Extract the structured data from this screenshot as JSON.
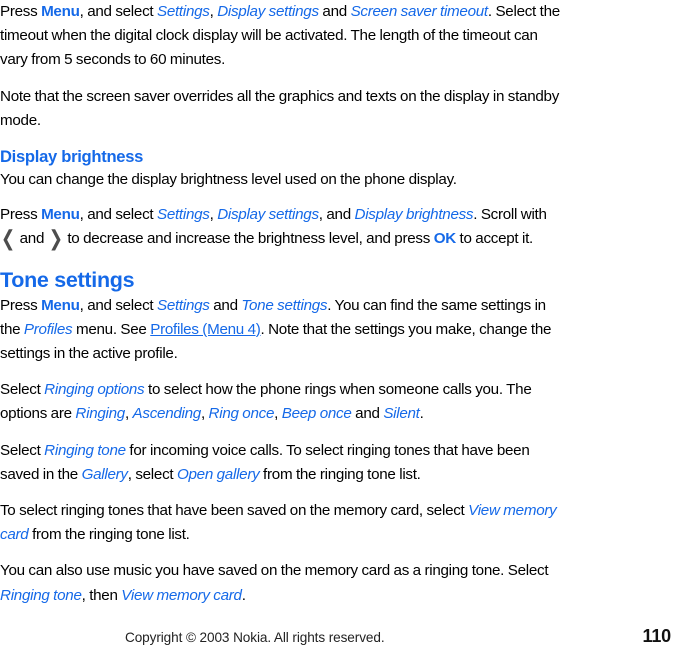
{
  "document": {
    "type": "user-guide-page",
    "accent_color": "#1569e8",
    "body_color": "#000000",
    "chevron_color": "#4d4d4d",
    "page_number": "110",
    "footer_copyright": "Copyright © 2003 Nokia. All rights reserved."
  },
  "blocks": {
    "p1": {
      "s1": "Press ",
      "ui_menu": "Menu",
      "s2": ", and select ",
      "it_settings": "Settings",
      "s3": ", ",
      "it_display_settings": "Display settings",
      "s4": " and ",
      "it_screen_saver_timeout": "Screen saver timeout",
      "s5": ". Select the timeout when the digital clock display will be activated. The length of the timeout can vary from 5 seconds to 60 minutes."
    },
    "p2": {
      "s1": "Note that the screen saver overrides all the graphics and texts on the display in standby mode."
    },
    "h_display_brightness": "Display brightness",
    "p3": {
      "s1": "You can change the display brightness level used on the phone display."
    },
    "p4": {
      "s1": "Press ",
      "ui_menu": "Menu",
      "s2": ", and select ",
      "it_settings": "Settings",
      "s3": ", ",
      "it_display_settings": "Display settings",
      "s4": ", and ",
      "it_display_brightness": "Display brightness",
      "s5": ". Scroll with ",
      "chev_left": "❮",
      "s6": " and ",
      "chev_right": "❯",
      "s7": " to decrease and increase the brightness level, and press ",
      "ui_ok": "OK",
      "s8": " to accept it."
    },
    "h_tone_settings": "Tone settings",
    "p5": {
      "s1": "Press ",
      "ui_menu": "Menu",
      "s2": ", and select ",
      "it_settings": "Settings",
      "s3": " and ",
      "it_tone_settings": "Tone settings",
      "s4": ". You can find the same settings in the ",
      "it_profiles": "Profiles",
      "s5": " menu. See ",
      "xref_profiles_menu4": "Profiles (Menu 4)",
      "s6": ". Note that the settings you make, change the settings in the active profile."
    },
    "p6": {
      "s1": "Select ",
      "it_ringing_options": "Ringing options",
      "s2": " to select how the phone rings when someone calls you. The options are ",
      "it_ringing": "Ringing",
      "s3": ", ",
      "it_ascending": "Ascending",
      "s4": ", ",
      "it_ring_once": "Ring once",
      "s5": ", ",
      "it_beep_once": "Beep once",
      "s6": " and ",
      "it_silent": "Silent",
      "s7": "."
    },
    "p7": {
      "s1": "Select ",
      "it_ringing_tone": "Ringing tone",
      "s2": " for incoming voice calls. To select ringing tones that have been saved in the ",
      "it_gallery": "Gallery",
      "s3": ", select ",
      "it_open_gallery": "Open gallery",
      "s4": " from the ringing tone list."
    },
    "p8": {
      "s1": "To select ringing tones that have been saved on the memory card, select ",
      "it_view_memory_card": "View memory card",
      "s2": " from the ringing tone list."
    },
    "p9": {
      "s1": "You can also use music you have saved on the memory card as a ringing tone. Select ",
      "it_ringing_tone": "Ringing tone",
      "s2": ", then ",
      "it_view_memory_card": "View memory card",
      "s3": "."
    }
  }
}
